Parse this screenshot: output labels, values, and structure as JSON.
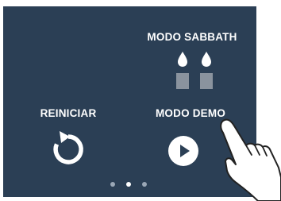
{
  "screen": {
    "background": "#2b3f55",
    "accent": "#ffffff"
  },
  "sabbath": {
    "label": "MODO SABBATH",
    "icon": "candles-icon"
  },
  "reiniciar": {
    "label": "REINICIAR",
    "icon": "restart-icon"
  },
  "demo": {
    "label": "MODO DEMO",
    "icon": "play-icon"
  },
  "pager": {
    "pages": 3,
    "active_page": 2
  },
  "overlay": {
    "icon": "pointing-hand-icon"
  }
}
